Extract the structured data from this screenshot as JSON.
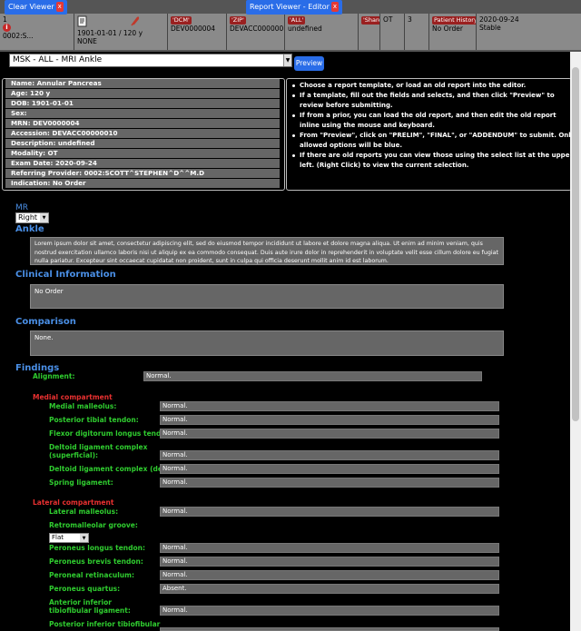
{
  "tabs": {
    "clear_viewer": "Clear Viewer",
    "report_viewer": "Report Viewer - Editor",
    "close": "x"
  },
  "header": {
    "row_num": "1",
    "patient_id": "0002:S...",
    "dob_age": "1901-01-01 / 120 y",
    "flag": "NONE",
    "dcm_badge": "'DCM'",
    "dcm_val": "DEV0000004",
    "zip_badge": "'ZIP'",
    "zip_val": "DEVACC000000...",
    "all_badge": "'ALL'",
    "all_val": "undefined",
    "share_badge": "'Share'",
    "modality": "OT",
    "count": "3",
    "history_badge": "Patient History",
    "history_val": "No Order",
    "date": "2020-09-24",
    "status": "Stable"
  },
  "template_select": {
    "value": "MSK - ALL - MRI Ankle",
    "preview_label": "Preview"
  },
  "patient_info": [
    "Name: Annular Pancreas",
    "Age: 120 y",
    "DOB: 1901-01-01",
    "Sex:",
    "MRN: DEV0000004",
    "Accession: DEVACC00000010",
    "Description: undefined",
    "Modality: OT",
    "Exam Date: 2020-09-24",
    "Referring Provider: 0002:SCOTT^STEPHEN^D^^M.D",
    "Indication: No Order"
  ],
  "instructions": [
    "Choose a report template, or load an old report into the editor.",
    "If a template, fill out the fields and selects, and then click \"Preview\" to review before submitting.",
    "If from a prior, you can load the old report, and then edit the old report inline using the mouse and keyboard.",
    "From \"Preview\", click on \"PRELIM\", \"FINAL\", or \"ADDENDUM\" to submit. Only allowed options will be blue.",
    "If there are old reports you can view those using the select list at the upper left. (Right Click) to view the current selection."
  ],
  "report": {
    "mr_label": "MR",
    "side_value": "Right",
    "ankle_label": "Ankle",
    "lorem": "Lorem ipsum dolor sit amet, consectetur adipiscing elit, sed do eiusmod tempor incididunt ut labore et dolore magna aliqua. Ut enim ad minim veniam, quis nostrud exercitation ullamco laboris nisi ut aliquip ex ea commodo consequat. Duis aute irure dolor in reprehenderit in voluptate velit esse cillum dolore eu fugiat nulla pariatur. Excepteur sint occaecat cupidatat non proident, sunt in culpa qui officia deserunt mollit anim id est laborum.",
    "clinical_title": "Clinical Information",
    "clinical_value": "No Order",
    "comparison_title": "Comparison",
    "comparison_value": "None.",
    "findings_title": "Findings",
    "alignment_label": "Alignment:",
    "alignment_value": "Normal.",
    "medial_title": "Medial compartment",
    "medial": [
      {
        "label": "Medial malleolus:",
        "value": "Normal."
      },
      {
        "label": "Posterior tibial tendon:",
        "value": "Normal."
      },
      {
        "label": "Flexor digitorum longus tendon:",
        "value": "Normal."
      },
      {
        "label": "Deltoid ligament complex (superficial):",
        "value": "Normal."
      },
      {
        "label": "Deltoid ligament complex (deep):",
        "value": "Normal."
      },
      {
        "label": "Spring ligament:",
        "value": "Normal."
      }
    ],
    "lateral_title": "Lateral compartment",
    "lateral_malleolus_label": "Lateral malleolus:",
    "lateral_malleolus_value": "Normal.",
    "retromalleolar_label": "Retromalleolar groove:",
    "retromalleolar_value": "Flat",
    "lateral": [
      {
        "label": "Peroneus longus tendon:",
        "value": "Normal."
      },
      {
        "label": "Peroneus brevis tendon:",
        "value": "Normal."
      },
      {
        "label": "Peroneal retinaculum:",
        "value": "Normal."
      },
      {
        "label": "Peroneus quartus:",
        "value": "Absent."
      },
      {
        "label": "Anterior inferior tibiofibular ligament:",
        "value": "Normal."
      },
      {
        "label": "Posterior inferior tibiofibular",
        "value": ""
      }
    ]
  },
  "colors": {
    "accent_blue": "#2a6de8",
    "close_red": "#e53935",
    "heading_blue": "#4a8fe6",
    "label_green": "#2fcc2f",
    "label_red": "#e83030"
  }
}
